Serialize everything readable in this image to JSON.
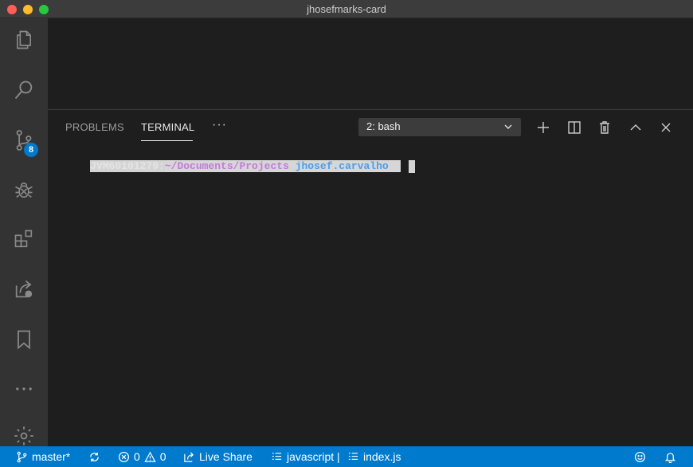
{
  "window": {
    "title": "jhosefmarks-card"
  },
  "activity_bar": {
    "scm_badge": "8",
    "items": [
      "explorer-icon",
      "search-icon",
      "source-control-icon",
      "debug-icon",
      "extensions-icon",
      "live-share-icon",
      "bookmarks-icon",
      "more-icon",
      "settings-icon"
    ]
  },
  "panel": {
    "tabs": [
      {
        "label": "PROBLEMS"
      },
      {
        "label": "TERMINAL"
      }
    ],
    "more_label": "···",
    "terminal_select": "2: bash"
  },
  "terminal": {
    "host": "JVM60101279:",
    "path": "~/Documents/Projects",
    "user": "jhosef.carvalho"
  },
  "statusbar": {
    "branch": "master*",
    "errors": "0",
    "warnings": "0",
    "live_share": "Live Share",
    "language": "javascript |",
    "file": "index.js"
  },
  "colors": {
    "accent": "#007acc",
    "activity_bg": "#333333",
    "panel_bg": "#1e1e1e"
  }
}
